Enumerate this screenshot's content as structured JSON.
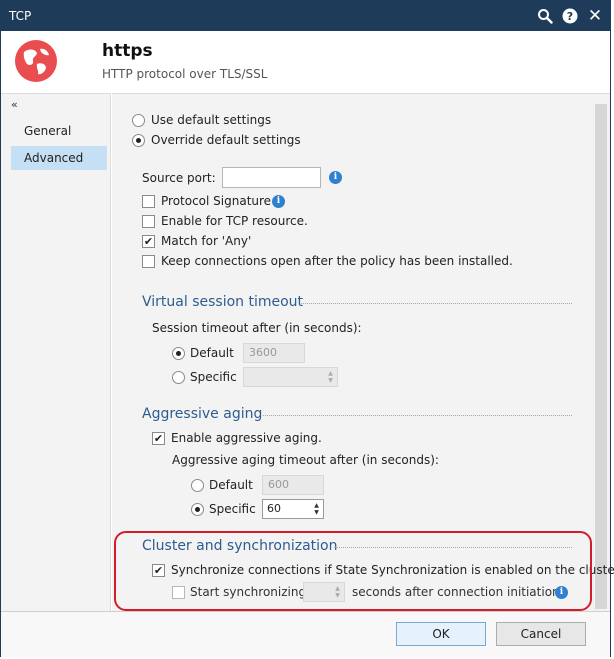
{
  "window": {
    "title": "TCP"
  },
  "titlebar_icons": {
    "search": "search-icon",
    "help": "help-icon",
    "help_glyph": "?",
    "close": "close-icon",
    "close_glyph": "✕"
  },
  "header": {
    "name": "https",
    "description": "HTTP protocol over TLS/SSL",
    "icon": "globe-icon",
    "icon_color": "#e94d4f"
  },
  "sidebar": {
    "collapse_glyph": "«",
    "items": [
      {
        "label": "General",
        "active": false
      },
      {
        "label": "Advanced",
        "active": true
      }
    ],
    "active_color": "#c5dff5"
  },
  "settings_mode": {
    "options": [
      "Use default settings",
      "Override default settings"
    ],
    "selected": "Override default settings"
  },
  "general": {
    "source_port_label": "Source port:",
    "source_port_value": "",
    "checkboxes": [
      {
        "label": "Protocol Signature",
        "checked": false,
        "info": true
      },
      {
        "label": "Enable for TCP resource.",
        "checked": false
      },
      {
        "label": "Match for 'Any'",
        "checked": true
      },
      {
        "label": "Keep connections open after the policy has been installed.",
        "checked": false
      }
    ]
  },
  "virtual_session_timeout": {
    "title": "Virtual session timeout",
    "prompt": "Session timeout after (in seconds):",
    "default_label": "Default",
    "default_value": "3600",
    "specific_label": "Specific",
    "specific_value": "",
    "selected": "Default"
  },
  "aggressive_aging": {
    "title": "Aggressive aging",
    "enable_label": "Enable aggressive aging.",
    "enabled": true,
    "prompt": "Aggressive aging timeout after (in seconds):",
    "default_label": "Default",
    "default_value": "600",
    "specific_label": "Specific",
    "specific_value": "60",
    "selected": "Specific"
  },
  "cluster_sync": {
    "title": "Cluster and synchronization",
    "sync_label": "Synchronize connections if State Synchronization is enabled on the cluster.",
    "sync_checked": true,
    "start_label": "Start synchronizing",
    "start_value": "",
    "start_suffix": "seconds after connection initiation.",
    "start_checked": false,
    "highlight_color": "#d41d2a"
  },
  "glyphs": {
    "check": "✔",
    "info": "i",
    "spin_up": "▲",
    "spin_down": "▼"
  },
  "colors": {
    "titlebar": "#1f3b5a",
    "section_title": "#2d5c8f",
    "info": "#2f80d1"
  },
  "footer": {
    "ok_label": "OK",
    "cancel_label": "Cancel"
  }
}
